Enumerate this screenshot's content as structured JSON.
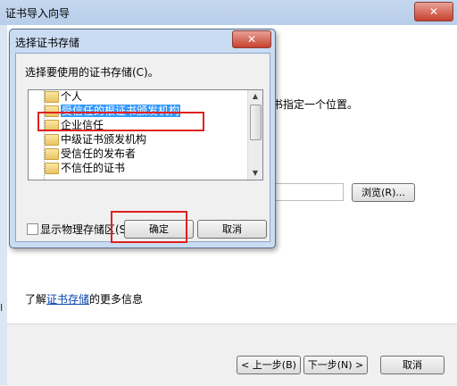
{
  "wizard": {
    "title": "证书导入向导",
    "close_glyph": "✕",
    "description": "书指定一个位置。",
    "browse_label": "浏览(R)...",
    "more_prefix": "了解",
    "more_link": "证书存储",
    "more_suffix": "的更多信息",
    "back_label": "< 上一步(B)",
    "next_label": "下一步(N) >",
    "cancel_label": "取消",
    "edge_char": "I"
  },
  "dialog": {
    "title": "选择证书存储",
    "close_glyph": "✕",
    "prompt": "选择要使用的证书存储(C)。",
    "tree_items": [
      {
        "label": "个人",
        "selected": false
      },
      {
        "label": "受信任的根证书颁发机构",
        "selected": true
      },
      {
        "label": "企业信任",
        "selected": false
      },
      {
        "label": "中级证书颁发机构",
        "selected": false
      },
      {
        "label": "受信任的发布者",
        "selected": false
      },
      {
        "label": "不信任的证书",
        "selected": false
      }
    ],
    "scroll_up": "▲",
    "scroll_down": "▼",
    "show_physical_label": "显示物理存储区(S)",
    "show_physical_checked": false,
    "ok_label": "确定",
    "cancel_label": "取消"
  },
  "colors": {
    "selection": "#3399ff",
    "highlight_box": "#e02020",
    "link": "#0645ad"
  }
}
